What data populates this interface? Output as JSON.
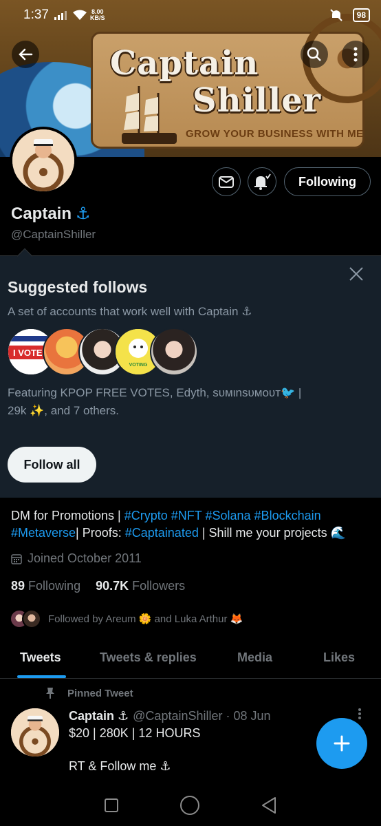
{
  "status_bar": {
    "time": "1:37",
    "speed_value": "8.00",
    "speed_unit": "KB/S",
    "battery": "98"
  },
  "banner": {
    "title_line1": "Captain",
    "title_line2": "Shiller",
    "tagline": "GROW YOUR BUSINESS WITH ME"
  },
  "profile": {
    "name": "Captain",
    "name_emoji": "⚓",
    "handle": "@CaptainShiller",
    "following_button": "Following",
    "bio_parts": [
      "DM for Promotions | ",
      "#Crypto",
      " ",
      "#NFT",
      " ",
      "#Solana",
      " ",
      "#Blockchain",
      " ",
      "#Metaverse",
      "| Proofs: ",
      "#Captainated",
      " | Shill me your projects 🌊"
    ],
    "joined": "Joined October 2011",
    "following_count": "89",
    "following_label": "Following",
    "followers_count": "90.7K",
    "followers_label": "Followers",
    "followed_by": "Followed by Areum 🌼 and Luka Arthur 🦊"
  },
  "suggested": {
    "title": "Suggested follows",
    "subtitle": "A set of accounts that work well with Captain ⚓",
    "avatar_labels": [
      "I VOTED",
      "",
      "",
      "VOTING",
      ""
    ],
    "featuring_line1": "Featuring KPOP FREE VOTES, Edyth, ѕυмιnѕυмoυт🐦 |",
    "featuring_line2": "29k ✨, and 7 others.",
    "follow_all": "Follow all"
  },
  "tabs": [
    {
      "label": "Tweets",
      "active": true
    },
    {
      "label": "Tweets & replies",
      "active": false
    },
    {
      "label": "Media",
      "active": false
    },
    {
      "label": "Likes",
      "active": false
    }
  ],
  "pinned_tweet": {
    "pinned_label": "Pinned Tweet",
    "name": "Captain ⚓",
    "handle_date": "@CaptainShiller · 08 Jun",
    "line1": "$20 | 280K | 12 HOURS",
    "line2": "RT & Follow me ⚓"
  },
  "colors": {
    "accent": "#1d9bf0",
    "background": "#000000",
    "panel": "#16202a"
  }
}
